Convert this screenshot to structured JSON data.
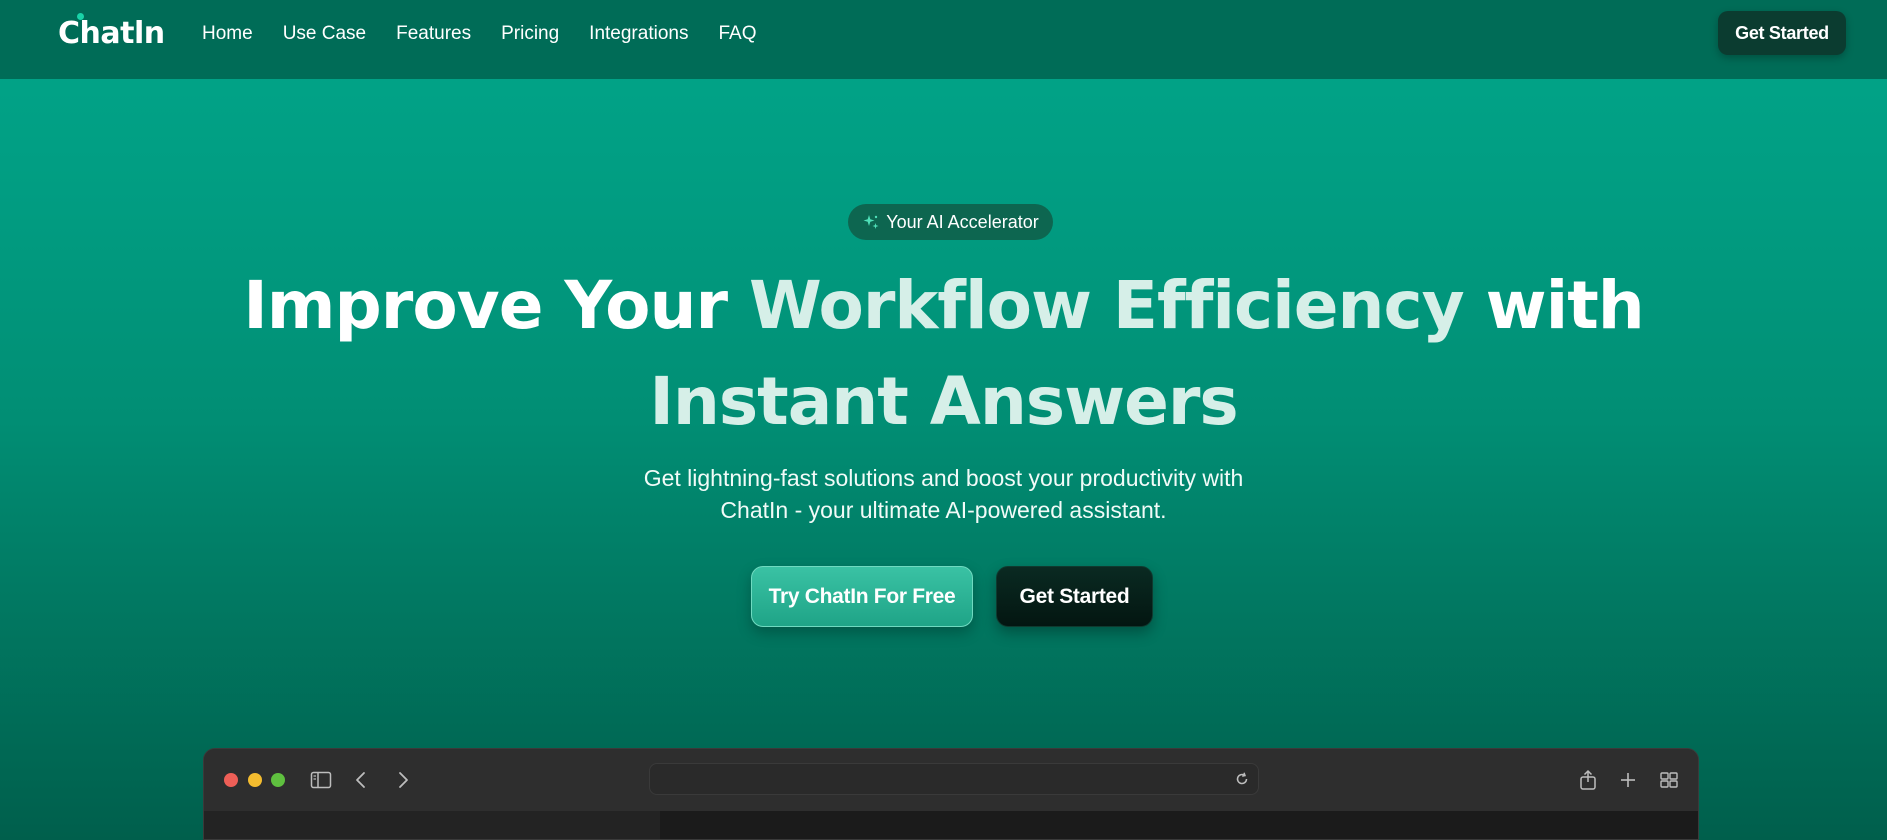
{
  "brand": {
    "name": "Chatln"
  },
  "nav": {
    "links": [
      "Home",
      "Use Case",
      "Features",
      "Pricing",
      "Integrations",
      "FAQ"
    ],
    "cta": "Get Started"
  },
  "hero": {
    "badge": "Your AI Accelerator",
    "headline_line1_a": "Improve Your ",
    "headline_line1_b": "Workflow Efficiency",
    "headline_line1_c": " with",
    "headline_line2": "Instant Answers",
    "subtext_line1": "Get lightning-fast solutions and boost your productivity with",
    "subtext_line2": "ChatIn - your ultimate AI-powered assistant.",
    "primary_button": "Try ChatIn For Free",
    "secondary_button": "Get Started"
  },
  "colors": {
    "nav_bg": "#006c57",
    "hero_top": "#01a68a",
    "hero_bottom": "#005f4c",
    "cta_dark": "#0b3c30",
    "primary_button": "#2bb496"
  },
  "browser_mock": {
    "icons": [
      "sidebar-icon",
      "back-icon",
      "forward-icon",
      "reload-icon",
      "share-icon",
      "plus-icon",
      "tabs-grid-icon"
    ]
  }
}
